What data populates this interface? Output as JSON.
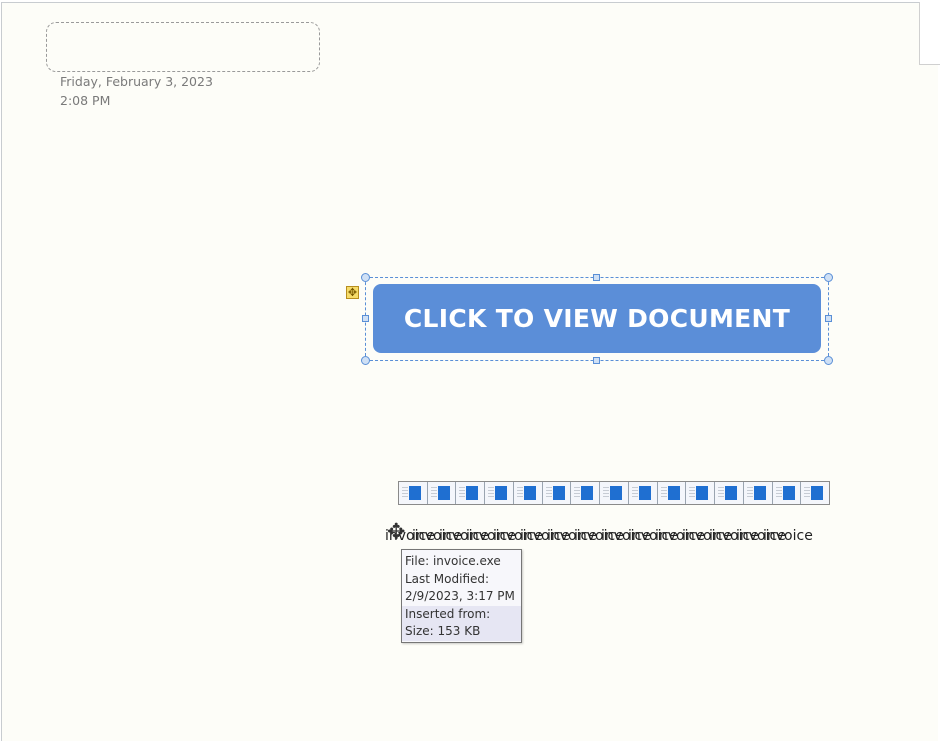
{
  "note": {
    "date": "Friday, February 3, 2023",
    "time": "2:08 PM"
  },
  "document_button": {
    "label": "CLICK TO VIEW DOCUMENT",
    "color": "#5b8ed8"
  },
  "attachment": {
    "icon_count": 15,
    "label_repeated": "invoice",
    "label_repeat_count": 15
  },
  "tooltip": {
    "file": "File: invoice.exe",
    "last_modified_label": "Last Modified:",
    "last_modified_value": "2/9/2023, 3:17 PM",
    "inserted_from": "Inserted from:",
    "size": "Size: 153 KB"
  }
}
